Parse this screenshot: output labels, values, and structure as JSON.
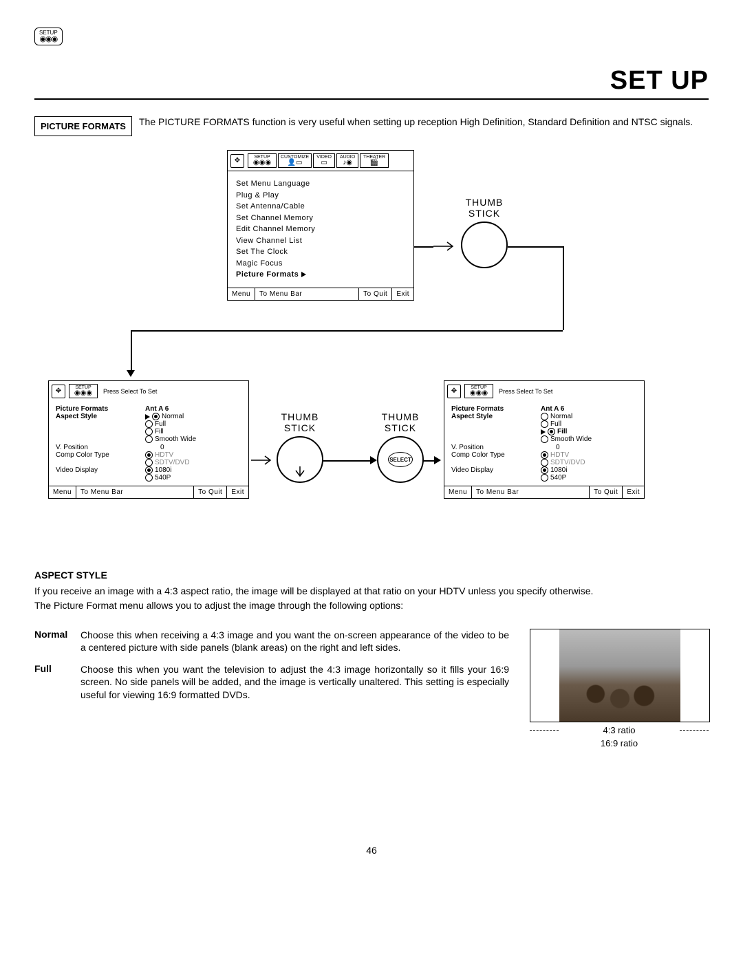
{
  "header": {
    "badge_label": "SETUP",
    "page_title": "SET UP"
  },
  "intro": {
    "section_label": "PICTURE FORMATS",
    "text": "The PICTURE FORMATS function is very useful when setting up reception High Definition, Standard Definition and NTSC signals."
  },
  "tabs": {
    "t1": "SETUP",
    "t2": "CUSTOMIZE",
    "t3": "VIDEO",
    "t4": "AUDIO",
    "t5": "THEATER"
  },
  "main_menu": {
    "items": [
      "Set Menu Language",
      "Plug & Play",
      "Set Antenna/Cable",
      "Set Channel Memory",
      "Edit Channel Memory",
      "View Channel List",
      "Set The Clock",
      "Magic Focus"
    ],
    "selected": "Picture Formats"
  },
  "footer": {
    "menu": "Menu",
    "tobar": "To Menu Bar",
    "toquit": "To Quit",
    "exit": "Exit"
  },
  "thumb": {
    "label1": "THUMB",
    "label2": "STICK",
    "select": "SELECT"
  },
  "sub_header": "Press Select To Set",
  "sub_title": "Picture Formats",
  "sub_ant": "Ant A 6",
  "sub": {
    "aspect_label": "Aspect Style",
    "normal": "Normal",
    "full": "Full",
    "fill": "Fill",
    "smooth": "Smooth Wide",
    "vpos_label": "V. Position",
    "vpos_val": "0",
    "comp_label": "Comp Color Type",
    "hdtv": "HDTV",
    "sdtv": "SDTV/DVD",
    "vdisp_label": "Video Display",
    "v1080i": "1080i",
    "v540p": "540P"
  },
  "aspect": {
    "heading": "ASPECT STYLE",
    "intro1": "If you receive an image with a 4:3 aspect ratio, the image will be displayed at that ratio on your HDTV unless you specify otherwise.",
    "intro2": "The Picture Format menu allows you to adjust the image through the following options:",
    "normal_label": "Normal",
    "normal_text": "Choose this when receiving a 4:3 image and you want the on-screen appearance of the video to be a centered picture with side panels (blank areas) on the right and left sides.",
    "full_label": "Full",
    "full_text": "Choose this when you want the television to adjust the 4:3 image horizontally so it fills your 16:9 screen. No side panels will be added, and the image is vertically unaltered. This setting is especially useful for viewing 16:9 formatted DVDs.",
    "ratio43": "4:3 ratio",
    "ratio169": "16:9 ratio"
  },
  "page_number": "46"
}
